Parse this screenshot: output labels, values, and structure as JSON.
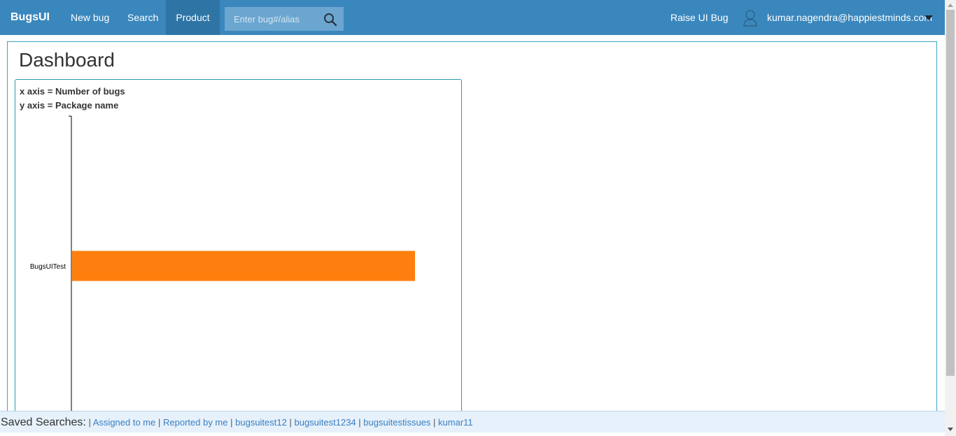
{
  "navbar": {
    "brand": "BugsUI",
    "new_bug": "New bug",
    "search": "Search",
    "product": "Product",
    "search_placeholder": "Enter bug#/alias",
    "raise_ui_bug": "Raise UI Bug",
    "user_email": "kumar.nagendra@happiestminds.com",
    "icons": [
      "search-icon",
      "user-icon",
      "caret-down-icon"
    ]
  },
  "dashboard": {
    "title": "Dashboard",
    "x_axis_note": "x axis = Number of bugs",
    "y_axis_note": "y axis = Package name"
  },
  "chart_data": {
    "type": "bar",
    "orientation": "horizontal",
    "categories": [
      "BugsUITest"
    ],
    "values": [
      1
    ],
    "bar_color": "#ff7f0e",
    "title": "",
    "xlabel": "",
    "ylabel": "",
    "grid": false
  },
  "saved_searches": {
    "label": "Saved Searches:",
    "items": [
      "Assigned to me",
      "Reported by me",
      "bugsuitest12",
      "bugsuitest1234",
      "bugsuitestissues",
      "kumar11"
    ]
  },
  "colors": {
    "navbar": "#3a87bd",
    "navbar_active": "#2e75a6",
    "panel_border": "#3ea3c4",
    "saved_bar": "#e6f1fb",
    "link": "#3a7fbf"
  }
}
